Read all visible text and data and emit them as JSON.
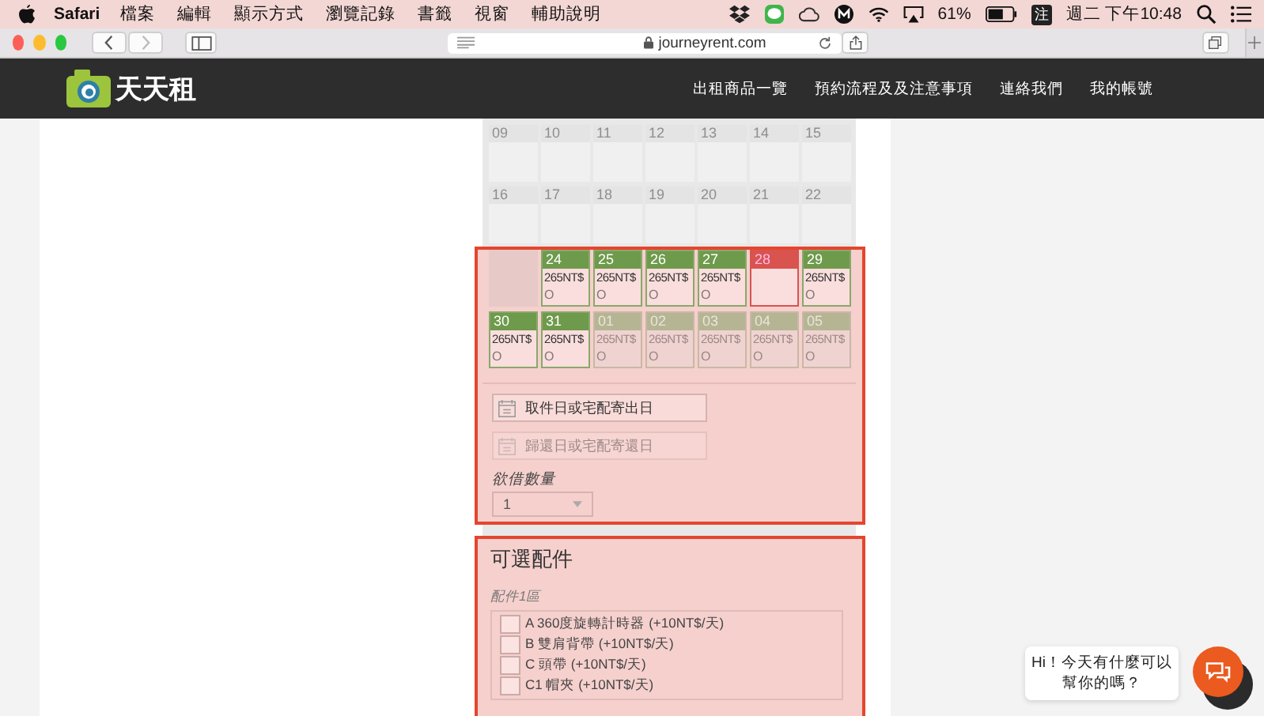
{
  "menu_bar": {
    "app": "Safari",
    "items": [
      "檔案",
      "編輯",
      "顯示方式",
      "瀏覽記錄",
      "書籤",
      "視窗",
      "輔助說明"
    ],
    "input_method": "注",
    "battery": "61%",
    "clock": "週二 下午10:48"
  },
  "browser": {
    "url": "journeyrent.com"
  },
  "site": {
    "logo": "天天租",
    "nav": [
      "出租商品一覽",
      "預約流程及及注意事項",
      "連絡我們",
      "我的帳號"
    ]
  },
  "calendar": {
    "weeks": [
      {
        "days": [
          {
            "kind": "past",
            "date": "09"
          },
          {
            "kind": "past",
            "date": "10"
          },
          {
            "kind": "past",
            "date": "11"
          },
          {
            "kind": "past",
            "date": "12"
          },
          {
            "kind": "past",
            "date": "13"
          },
          {
            "kind": "past",
            "date": "14"
          },
          {
            "kind": "past",
            "date": "15"
          }
        ]
      },
      {
        "days": [
          {
            "kind": "past",
            "date": "16"
          },
          {
            "kind": "past",
            "date": "17"
          },
          {
            "kind": "past",
            "date": "18"
          },
          {
            "kind": "past",
            "date": "19"
          },
          {
            "kind": "past",
            "date": "20"
          },
          {
            "kind": "past",
            "date": "21"
          },
          {
            "kind": "past",
            "date": "22"
          }
        ]
      }
    ]
  },
  "booking": {
    "highlighted": true,
    "weeks": [
      {
        "days": [
          {
            "kind": "blank"
          },
          {
            "kind": "open",
            "date": "24",
            "price": "265NT$",
            "mark": "O"
          },
          {
            "kind": "open",
            "date": "25",
            "price": "265NT$",
            "mark": "O"
          },
          {
            "kind": "open",
            "date": "26",
            "price": "265NT$",
            "mark": "O"
          },
          {
            "kind": "open",
            "date": "27",
            "price": "265NT$",
            "mark": "O"
          },
          {
            "kind": "booked",
            "date": "28"
          },
          {
            "kind": "open",
            "date": "29",
            "price": "265NT$",
            "mark": "O"
          }
        ]
      },
      {
        "days": [
          {
            "kind": "open",
            "date": "30",
            "price": "265NT$",
            "mark": "O"
          },
          {
            "kind": "open",
            "date": "31",
            "price": "265NT$",
            "mark": "O"
          },
          {
            "kind": "closed",
            "date": "01",
            "price": "265NT$",
            "mark": "O"
          },
          {
            "kind": "closed",
            "date": "02",
            "price": "265NT$",
            "mark": "O"
          },
          {
            "kind": "closed",
            "date": "03",
            "price": "265NT$",
            "mark": "O"
          },
          {
            "kind": "closed",
            "date": "04",
            "price": "265NT$",
            "mark": "O"
          },
          {
            "kind": "closed",
            "date": "05",
            "price": "265NT$",
            "mark": "O"
          }
        ]
      }
    ],
    "pickup": {
      "placeholder": "取件日或宅配寄出日",
      "disabled": false
    },
    "return": {
      "placeholder": "歸還日或宅配寄還日",
      "disabled": true
    },
    "quantity_label": "欲借數量",
    "quantity": "1"
  },
  "accessories": {
    "highlighted": true,
    "title": "可選配件",
    "group_label": "配件1區",
    "items": [
      {
        "label": "A 360度旋轉計時器 (+10NT$/天)",
        "checked": false
      },
      {
        "label": "B 雙肩背帶 (+10NT$/天)",
        "checked": false
      },
      {
        "label": "C 頭帶 (+10NT$/天)",
        "checked": false
      },
      {
        "label": "C1 帽夾 (+10NT$/天)",
        "checked": false
      }
    ]
  },
  "chat": {
    "message": "Hi！今天有什麼可以幫你的嗎？"
  }
}
